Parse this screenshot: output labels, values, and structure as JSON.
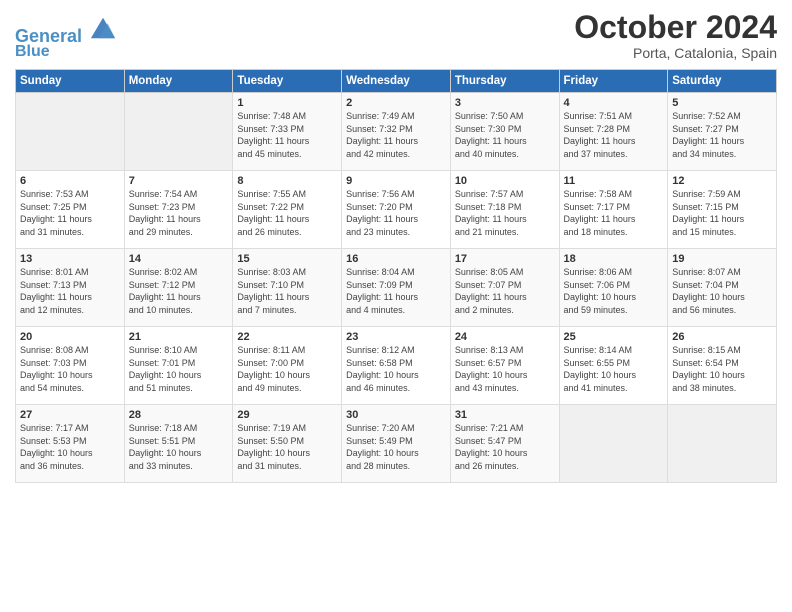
{
  "header": {
    "logo_line1": "General",
    "logo_line2": "Blue",
    "month": "October 2024",
    "location": "Porta, Catalonia, Spain"
  },
  "days_of_week": [
    "Sunday",
    "Monday",
    "Tuesday",
    "Wednesday",
    "Thursday",
    "Friday",
    "Saturday"
  ],
  "weeks": [
    [
      {
        "day": "",
        "info": ""
      },
      {
        "day": "",
        "info": ""
      },
      {
        "day": "1",
        "info": "Sunrise: 7:48 AM\nSunset: 7:33 PM\nDaylight: 11 hours\nand 45 minutes."
      },
      {
        "day": "2",
        "info": "Sunrise: 7:49 AM\nSunset: 7:32 PM\nDaylight: 11 hours\nand 42 minutes."
      },
      {
        "day": "3",
        "info": "Sunrise: 7:50 AM\nSunset: 7:30 PM\nDaylight: 11 hours\nand 40 minutes."
      },
      {
        "day": "4",
        "info": "Sunrise: 7:51 AM\nSunset: 7:28 PM\nDaylight: 11 hours\nand 37 minutes."
      },
      {
        "day": "5",
        "info": "Sunrise: 7:52 AM\nSunset: 7:27 PM\nDaylight: 11 hours\nand 34 minutes."
      }
    ],
    [
      {
        "day": "6",
        "info": "Sunrise: 7:53 AM\nSunset: 7:25 PM\nDaylight: 11 hours\nand 31 minutes."
      },
      {
        "day": "7",
        "info": "Sunrise: 7:54 AM\nSunset: 7:23 PM\nDaylight: 11 hours\nand 29 minutes."
      },
      {
        "day": "8",
        "info": "Sunrise: 7:55 AM\nSunset: 7:22 PM\nDaylight: 11 hours\nand 26 minutes."
      },
      {
        "day": "9",
        "info": "Sunrise: 7:56 AM\nSunset: 7:20 PM\nDaylight: 11 hours\nand 23 minutes."
      },
      {
        "day": "10",
        "info": "Sunrise: 7:57 AM\nSunset: 7:18 PM\nDaylight: 11 hours\nand 21 minutes."
      },
      {
        "day": "11",
        "info": "Sunrise: 7:58 AM\nSunset: 7:17 PM\nDaylight: 11 hours\nand 18 minutes."
      },
      {
        "day": "12",
        "info": "Sunrise: 7:59 AM\nSunset: 7:15 PM\nDaylight: 11 hours\nand 15 minutes."
      }
    ],
    [
      {
        "day": "13",
        "info": "Sunrise: 8:01 AM\nSunset: 7:13 PM\nDaylight: 11 hours\nand 12 minutes."
      },
      {
        "day": "14",
        "info": "Sunrise: 8:02 AM\nSunset: 7:12 PM\nDaylight: 11 hours\nand 10 minutes."
      },
      {
        "day": "15",
        "info": "Sunrise: 8:03 AM\nSunset: 7:10 PM\nDaylight: 11 hours\nand 7 minutes."
      },
      {
        "day": "16",
        "info": "Sunrise: 8:04 AM\nSunset: 7:09 PM\nDaylight: 11 hours\nand 4 minutes."
      },
      {
        "day": "17",
        "info": "Sunrise: 8:05 AM\nSunset: 7:07 PM\nDaylight: 11 hours\nand 2 minutes."
      },
      {
        "day": "18",
        "info": "Sunrise: 8:06 AM\nSunset: 7:06 PM\nDaylight: 10 hours\nand 59 minutes."
      },
      {
        "day": "19",
        "info": "Sunrise: 8:07 AM\nSunset: 7:04 PM\nDaylight: 10 hours\nand 56 minutes."
      }
    ],
    [
      {
        "day": "20",
        "info": "Sunrise: 8:08 AM\nSunset: 7:03 PM\nDaylight: 10 hours\nand 54 minutes."
      },
      {
        "day": "21",
        "info": "Sunrise: 8:10 AM\nSunset: 7:01 PM\nDaylight: 10 hours\nand 51 minutes."
      },
      {
        "day": "22",
        "info": "Sunrise: 8:11 AM\nSunset: 7:00 PM\nDaylight: 10 hours\nand 49 minutes."
      },
      {
        "day": "23",
        "info": "Sunrise: 8:12 AM\nSunset: 6:58 PM\nDaylight: 10 hours\nand 46 minutes."
      },
      {
        "day": "24",
        "info": "Sunrise: 8:13 AM\nSunset: 6:57 PM\nDaylight: 10 hours\nand 43 minutes."
      },
      {
        "day": "25",
        "info": "Sunrise: 8:14 AM\nSunset: 6:55 PM\nDaylight: 10 hours\nand 41 minutes."
      },
      {
        "day": "26",
        "info": "Sunrise: 8:15 AM\nSunset: 6:54 PM\nDaylight: 10 hours\nand 38 minutes."
      }
    ],
    [
      {
        "day": "27",
        "info": "Sunrise: 7:17 AM\nSunset: 5:53 PM\nDaylight: 10 hours\nand 36 minutes."
      },
      {
        "day": "28",
        "info": "Sunrise: 7:18 AM\nSunset: 5:51 PM\nDaylight: 10 hours\nand 33 minutes."
      },
      {
        "day": "29",
        "info": "Sunrise: 7:19 AM\nSunset: 5:50 PM\nDaylight: 10 hours\nand 31 minutes."
      },
      {
        "day": "30",
        "info": "Sunrise: 7:20 AM\nSunset: 5:49 PM\nDaylight: 10 hours\nand 28 minutes."
      },
      {
        "day": "31",
        "info": "Sunrise: 7:21 AM\nSunset: 5:47 PM\nDaylight: 10 hours\nand 26 minutes."
      },
      {
        "day": "",
        "info": ""
      },
      {
        "day": "",
        "info": ""
      }
    ]
  ]
}
